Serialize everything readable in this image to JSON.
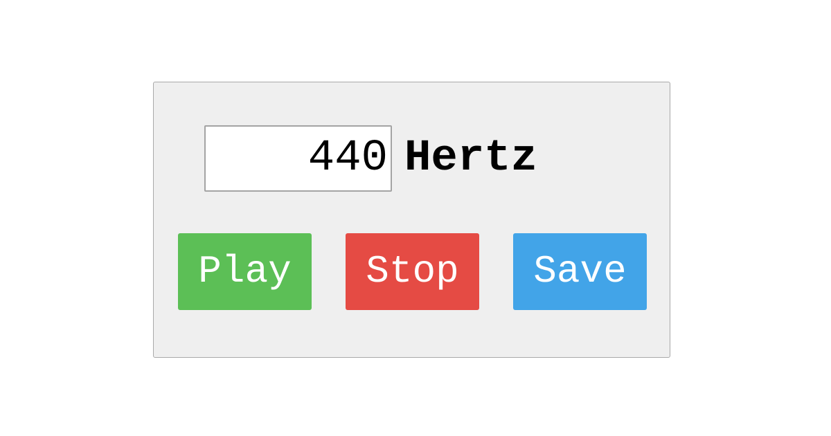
{
  "frequency": {
    "value": "440",
    "unit": "Hertz"
  },
  "buttons": {
    "play": {
      "label": "Play",
      "color": "#5cbf56"
    },
    "stop": {
      "label": "Stop",
      "color": "#e54b44"
    },
    "save": {
      "label": "Save",
      "color": "#42a4e8"
    }
  },
  "colors": {
    "panel_background": "#efefef",
    "panel_border": "#a8a8a8",
    "page_background": "#ffffff"
  }
}
